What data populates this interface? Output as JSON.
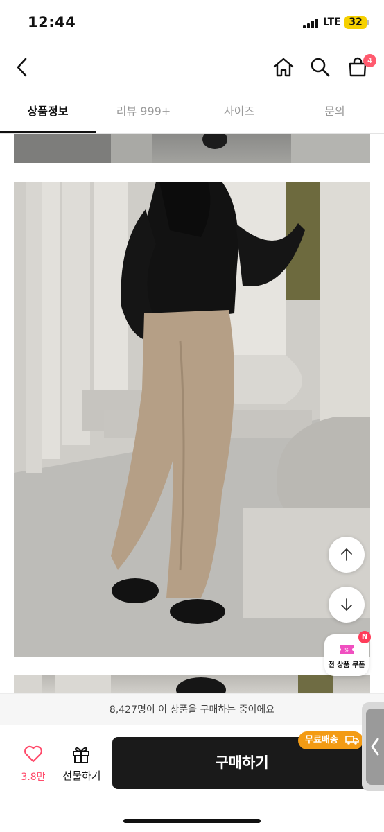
{
  "status_bar": {
    "time": "12:44",
    "network": "LTE",
    "battery": "32"
  },
  "nav": {
    "back_icon": "chevron-left-icon",
    "home_icon": "home-icon",
    "search_icon": "search-icon",
    "cart_icon": "shopping-bag-icon",
    "cart_count": "4"
  },
  "tabs": [
    {
      "label": "상품정보",
      "active": true
    },
    {
      "label": "리뷰 999+",
      "active": false
    },
    {
      "label": "사이즈",
      "active": false
    },
    {
      "label": "문의",
      "active": false
    }
  ],
  "floating": {
    "scroll_up_icon": "arrow-up-icon",
    "scroll_down_icon": "arrow-down-icon",
    "coupon_badge": "N",
    "coupon_label": "전 상품 쿠폰"
  },
  "buyers_notice": "8,427명이 이 상품을 구매하는 중이에요",
  "bottom_bar": {
    "wish_count": "3.8만",
    "gift_label": "선물하기",
    "free_shipping": "무료배송",
    "buy_label": "구매하기"
  },
  "colors": {
    "accent_pink": "#ff4b6b",
    "free_ship_orange": "#f39b14",
    "buy_button": "#1a1a1a",
    "battery": "#f5d000"
  }
}
